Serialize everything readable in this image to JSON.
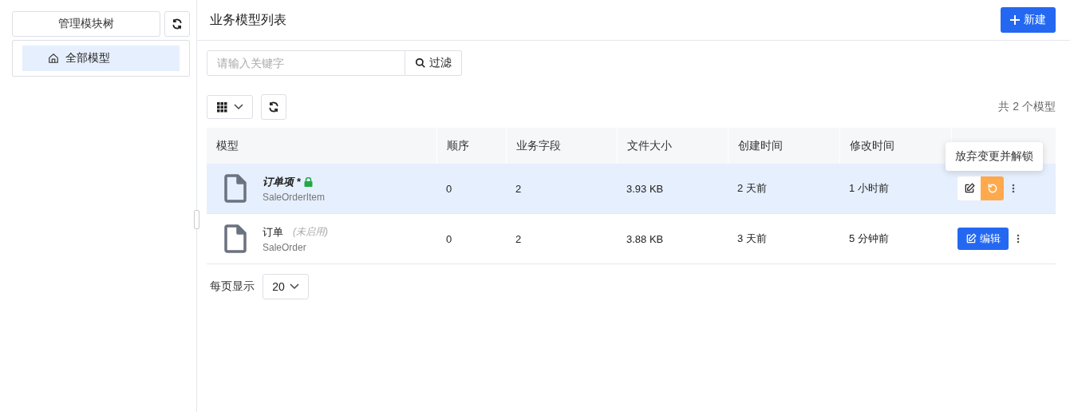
{
  "sidebar": {
    "title_button": "管理模块树",
    "tree": [
      {
        "label": "全部模型",
        "selected": true
      }
    ]
  },
  "main": {
    "title": "业务模型列表",
    "new_button": "新建",
    "search": {
      "placeholder": "请输入关键字",
      "button": "过滤"
    },
    "total": "共 2 个模型",
    "table": {
      "columns": [
        "模型",
        "顺序",
        "业务字段",
        "文件大小",
        "创建时间",
        "修改时间"
      ],
      "rows": [
        {
          "selected": true,
          "dirty": true,
          "locked": true,
          "name": "订单项 *",
          "code": "SaleOrderItem",
          "order": "0",
          "fields": "2",
          "size": "3.93 KB",
          "created": "2 天前",
          "modified": "1 小时前",
          "tooltip": "放弃变更并解锁"
        },
        {
          "selected": false,
          "dirty": false,
          "locked": false,
          "name": "订单",
          "note": "(未启用)",
          "code": "SaleOrder",
          "order": "0",
          "fields": "2",
          "size": "3.88 KB",
          "created": "3 天前",
          "modified": "5 分钟前",
          "edit_label": "编辑"
        }
      ]
    },
    "pagination": {
      "label": "每页显示",
      "page_size": "20"
    }
  }
}
